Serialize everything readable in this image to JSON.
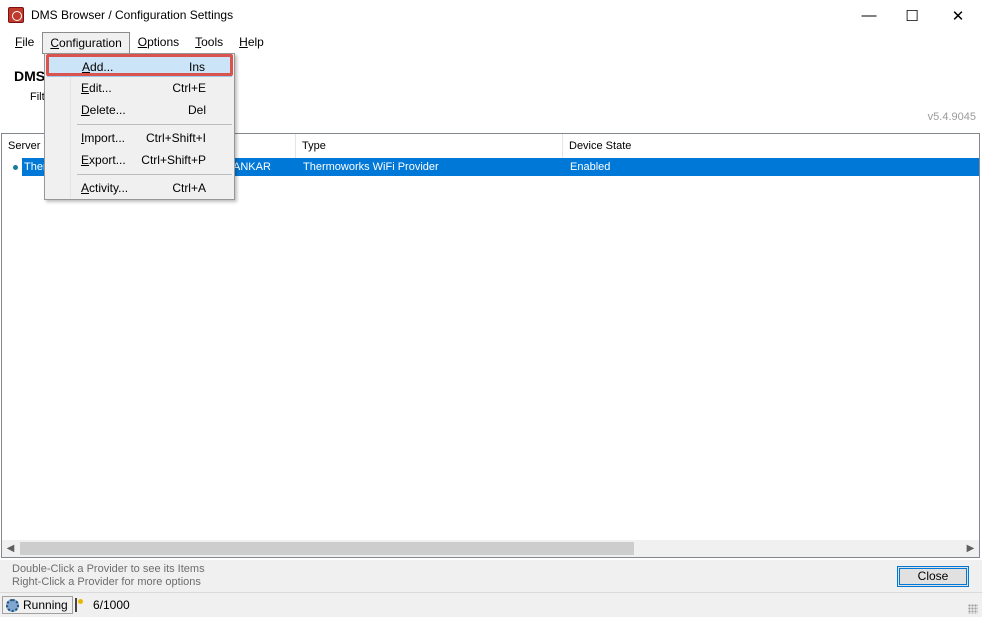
{
  "window": {
    "title": "DMS Browser / Configuration Settings",
    "minimize": "—",
    "maximize": "☐",
    "close": "✕"
  },
  "menubar": {
    "items": [
      {
        "label": "File"
      },
      {
        "label": "Configuration"
      },
      {
        "label": "Options"
      },
      {
        "label": "Tools"
      },
      {
        "label": "Help"
      }
    ]
  },
  "header": {
    "title": "DMS",
    "filter_label": "Filt",
    "version": "v5.4.9045"
  },
  "list": {
    "columns": [
      "Server",
      "Type",
      "Device State"
    ],
    "rows": [
      {
        "server": "Ther",
        "server_tail": "ANKAR",
        "type": "Thermoworks WiFi Provider",
        "state": "Enabled"
      }
    ]
  },
  "dropdown": {
    "items": [
      {
        "label": "Add...",
        "shortcut": "Ins"
      },
      {
        "label": "Edit...",
        "shortcut": "Ctrl+E"
      },
      {
        "label": "Delete...",
        "shortcut": "Del"
      },
      {
        "label": "Import...",
        "shortcut": "Ctrl+Shift+I"
      },
      {
        "label": "Export...",
        "shortcut": "Ctrl+Shift+P"
      },
      {
        "label": "Activity...",
        "shortcut": "Ctrl+A"
      }
    ]
  },
  "hints": {
    "line1": "Double-Click  a Provider to see its Items",
    "line2": "Right-Click  a Provider for more options"
  },
  "buttons": {
    "close": "Close"
  },
  "status": {
    "running": "Running",
    "count": "6/1000"
  },
  "colors": {
    "selection": "#0078d7",
    "highlight_border": "#d9534f",
    "menu_highlight": "#cce4f7"
  }
}
